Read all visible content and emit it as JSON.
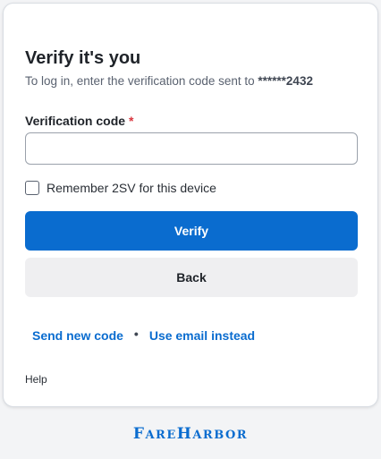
{
  "form": {
    "title": "Verify it's you",
    "subtitle_prefix": "To log in, enter the verification code sent to ",
    "masked_phone": "******2432",
    "code_label": "Verification code",
    "required_mark": "*",
    "code_value": "",
    "remember_label": "Remember 2SV for this device",
    "remember_checked": false,
    "verify_label": "Verify",
    "back_label": "Back",
    "send_new_code_label": "Send new code",
    "separator": "•",
    "use_email_label": "Use email instead",
    "help_label": "Help"
  },
  "brand": {
    "name": "FareHarbor",
    "part1_initial": "F",
    "part1_rest": "ARE",
    "part2_initial": "H",
    "part2_rest": "ARBOR"
  },
  "colors": {
    "primary": "#0a6ccf",
    "required": "#d9363e",
    "background": "#f3f4f6"
  }
}
